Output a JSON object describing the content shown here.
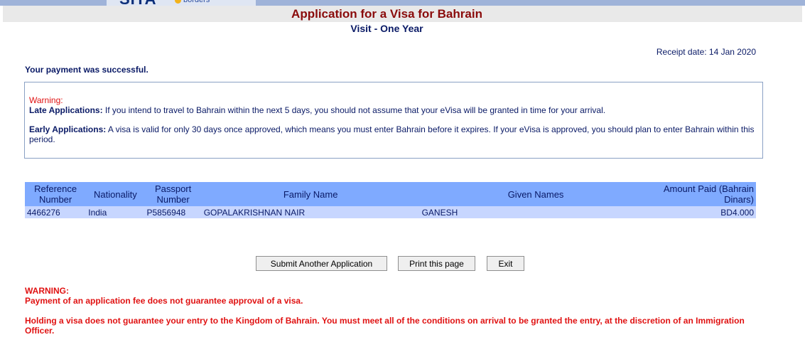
{
  "header": {
    "logo_text": "SITA",
    "logo_sub": "borders",
    "title": "Application for a Visa for Bahrain",
    "subtitle": "Visit - One Year"
  },
  "receipt": "Receipt date: 14 Jan 2020",
  "payment_status": "Your payment was successful.",
  "warning_box": {
    "title": "Warning:",
    "late_label": "Late Applications:",
    "late_text": " If you intend to travel to Bahrain within the next 5 days, you should not assume that your eVisa will be granted in time for your arrival.",
    "early_label": "Early Applications:",
    "early_text": " A visa is valid for only 30 days once approved, which means you must enter Bahrain before it expires. If your eVisa is approved, you should plan to enter Bahrain within this period."
  },
  "table": {
    "headers": {
      "reference": "Reference Number",
      "nationality": "Nationality",
      "passport": "Passport Number",
      "family": "Family Name",
      "given": "Given Names",
      "amount": "Amount Paid (Bahrain Dinars)"
    },
    "row": {
      "reference": "4466276",
      "nationality": "India",
      "passport": "P5856948",
      "family": "GOPALAKRISHNAN NAIR",
      "given": "GANESH",
      "amount": "BD4.000"
    }
  },
  "buttons": {
    "submit": "Submit Another Application",
    "print": "Print this page",
    "exit": "Exit"
  },
  "bottom_warning": {
    "title": "WARNING:",
    "line1": "Payment of an application fee does not guarantee approval of a visa.",
    "line2": "Holding a visa does not guarantee your entry to the Kingdom of Bahrain. You must meet all of the conditions on arrival to be granted the entry, at the discretion of an Immigration Officer."
  },
  "colors": {
    "title": "#8a0b0b",
    "text_navy": "#0a1a66",
    "warning_red": "#e01212",
    "table_header": "#7faaff",
    "table_row": "#c7d6ff"
  }
}
